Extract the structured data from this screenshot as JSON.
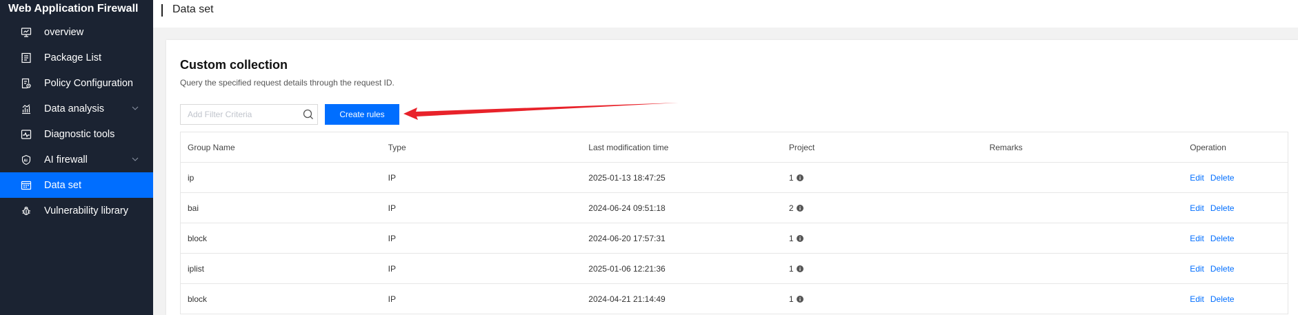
{
  "app": {
    "title": "Web Application Firewall"
  },
  "sidebar": {
    "items": [
      {
        "label": "overview",
        "icon": "monitor-icon",
        "expandable": false,
        "active": false
      },
      {
        "label": "Package List",
        "icon": "package-list-icon",
        "expandable": false,
        "active": false
      },
      {
        "label": "Policy Configuration",
        "icon": "policy-config-icon",
        "expandable": false,
        "active": false
      },
      {
        "label": "Data analysis",
        "icon": "data-analysis-icon",
        "expandable": true,
        "active": false
      },
      {
        "label": "Diagnostic tools",
        "icon": "diagnostic-icon",
        "expandable": false,
        "active": false
      },
      {
        "label": "AI firewall",
        "icon": "ai-firewall-icon",
        "expandable": true,
        "active": false
      },
      {
        "label": "Data set",
        "icon": "data-set-icon",
        "expandable": false,
        "active": true
      },
      {
        "label": "Vulnerability library",
        "icon": "bug-icon",
        "expandable": false,
        "active": false
      }
    ]
  },
  "header": {
    "title": "Data set"
  },
  "main": {
    "title": "Custom collection",
    "description": "Query the specified request details through the request ID.",
    "search": {
      "placeholder": "Add Filter Criteria",
      "value": ""
    },
    "create_button": "Create rules",
    "table": {
      "columns": [
        "Group Name",
        "Type",
        "Last modification time",
        "Project",
        "Remarks",
        "Operation"
      ],
      "rows": [
        {
          "group": "ip",
          "type": "IP",
          "time": "2025-01-13 18:47:25",
          "project": "1",
          "remarks": ""
        },
        {
          "group": "bai",
          "type": "IP",
          "time": "2024-06-24 09:51:18",
          "project": "2",
          "remarks": ""
        },
        {
          "group": "block",
          "type": "IP",
          "time": "2024-06-20 17:57:31",
          "project": "1",
          "remarks": ""
        },
        {
          "group": "iplist",
          "type": "IP",
          "time": "2025-01-06 12:21:36",
          "project": "1",
          "remarks": ""
        },
        {
          "group": "block",
          "type": "IP",
          "time": "2024-04-21 21:14:49",
          "project": "1",
          "remarks": ""
        }
      ],
      "edit_label": "Edit",
      "delete_label": "Delete"
    }
  },
  "colors": {
    "sidebar_bg": "#1b2332",
    "accent": "#006eff",
    "annotation_arrow": "#e8222a"
  }
}
